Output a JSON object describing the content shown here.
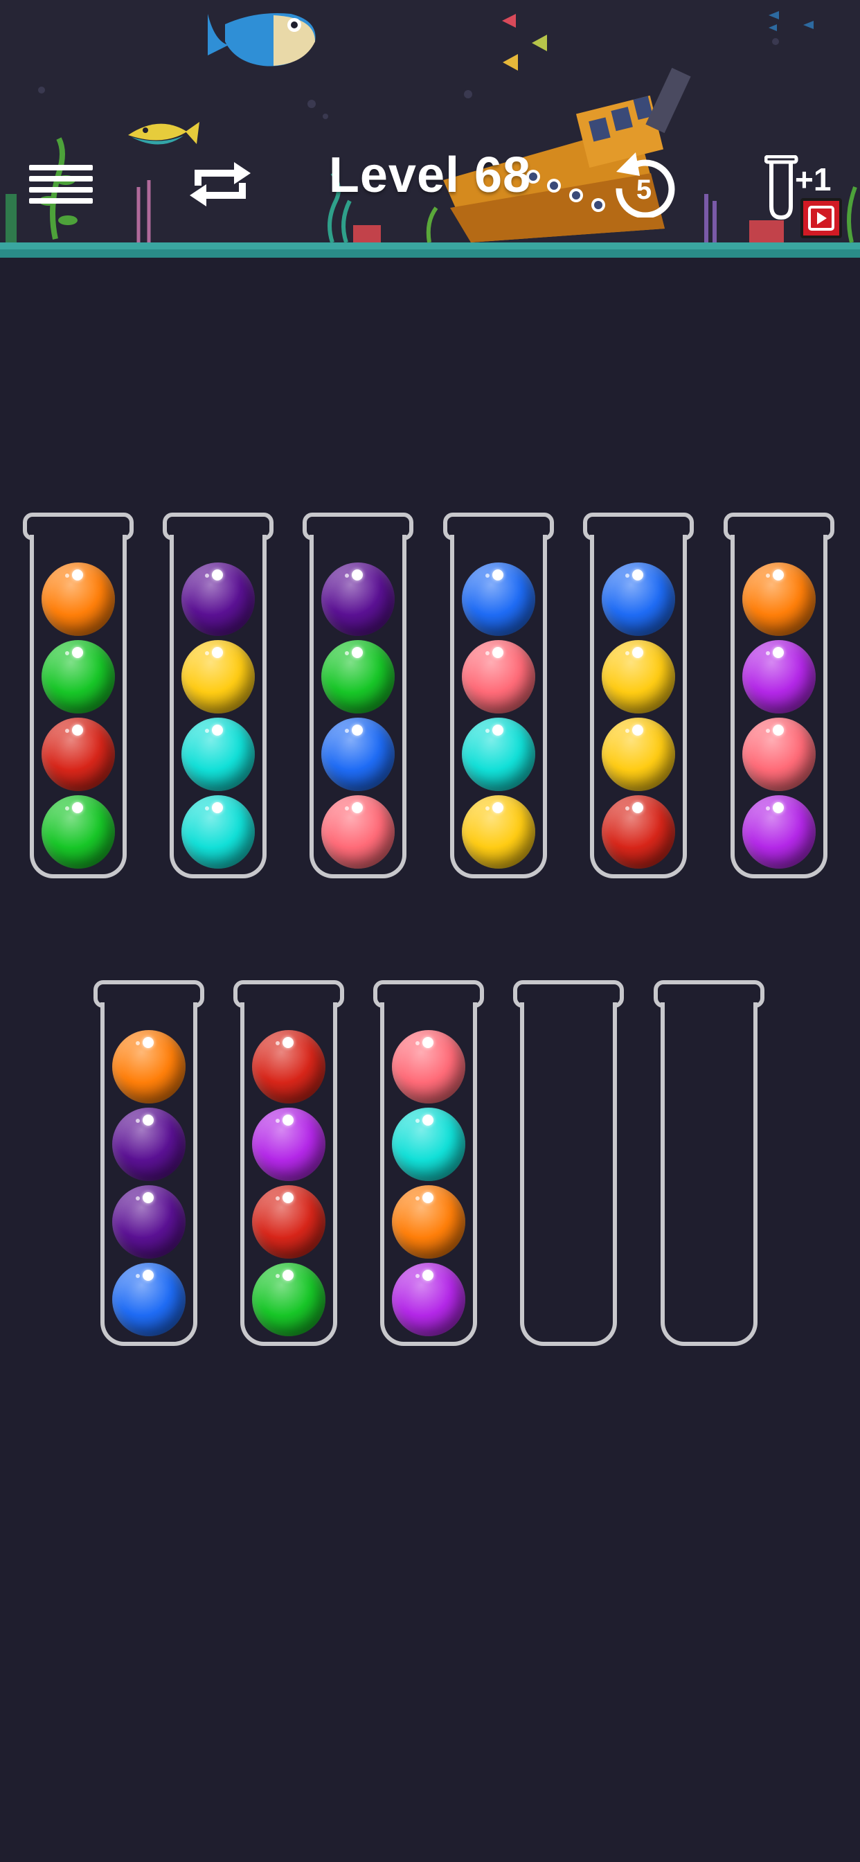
{
  "header": {
    "level_label": "Level 68",
    "undo_count": "5",
    "add_tube_label": "+1",
    "icons": {
      "menu": "hamburger-menu-icon",
      "restart": "restart-arrows-icon",
      "undo": "undo-icon",
      "add_tube": "add-tube-icon",
      "video_ad": "video-play-icon"
    }
  },
  "colors": {
    "orange": "#ff7f0a",
    "green": "#18c728",
    "red": "#d8261a",
    "darkpurple": "#5b1194",
    "yellow": "#ffcc14",
    "cyan": "#12e0d8",
    "blue": "#1f6cf5",
    "pink": "#ff6b78",
    "violet": "#b428e8",
    "background": "#1f1e2e",
    "tube_outline": "#c8c8cc",
    "ad_badge": "#d11a24"
  },
  "tubes": [
    {
      "id": 1,
      "balls": [
        "orange",
        "green",
        "red",
        "green"
      ]
    },
    {
      "id": 2,
      "balls": [
        "darkpurple",
        "yellow",
        "cyan",
        "cyan"
      ]
    },
    {
      "id": 3,
      "balls": [
        "darkpurple",
        "green",
        "blue",
        "pink"
      ]
    },
    {
      "id": 4,
      "balls": [
        "blue",
        "pink",
        "cyan",
        "yellow"
      ]
    },
    {
      "id": 5,
      "balls": [
        "blue",
        "yellow",
        "yellow",
        "red"
      ]
    },
    {
      "id": 6,
      "balls": [
        "orange",
        "violet",
        "pink",
        "violet"
      ]
    },
    {
      "id": 7,
      "balls": [
        "orange",
        "darkpurple",
        "darkpurple",
        "blue"
      ]
    },
    {
      "id": 8,
      "balls": [
        "red",
        "violet",
        "red",
        "green"
      ]
    },
    {
      "id": 9,
      "balls": [
        "pink",
        "cyan",
        "orange",
        "violet"
      ]
    },
    {
      "id": 10,
      "balls": []
    },
    {
      "id": 11,
      "balls": []
    }
  ]
}
